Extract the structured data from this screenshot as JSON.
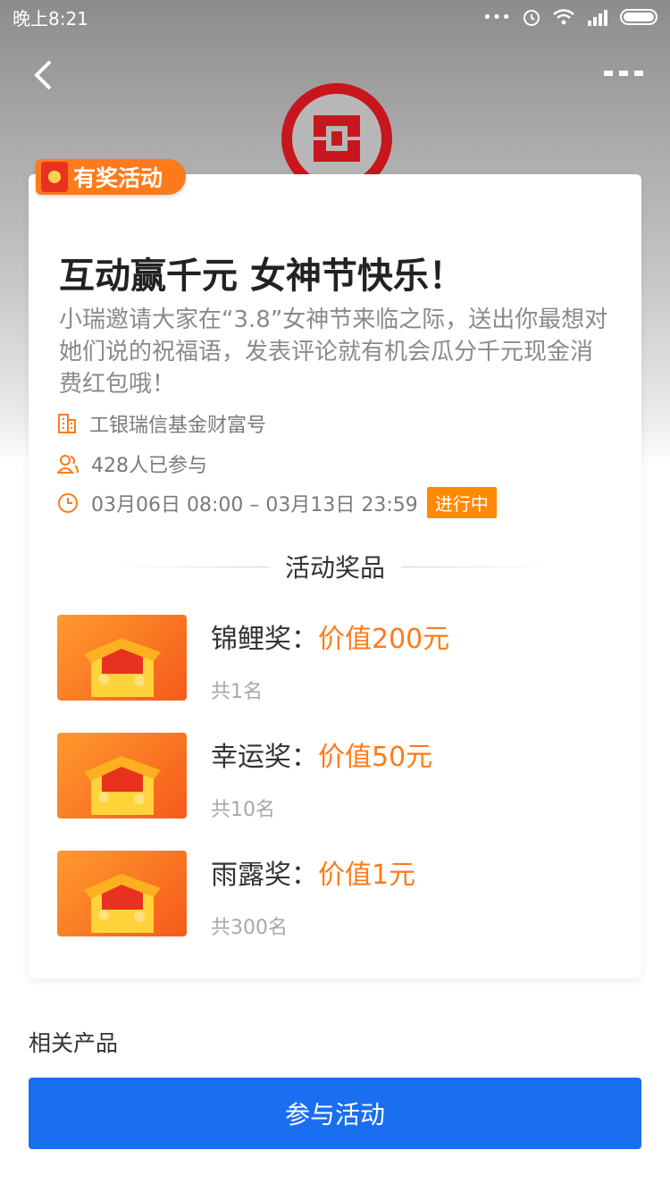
{
  "status_bar": {
    "time": "晚上8:21",
    "dots": "•••",
    "alarm_icon": "alarm-icon",
    "wifi_icon": "wifi-icon",
    "signal_icon": "signal-icon",
    "battery_icon": "battery-icon"
  },
  "nav": {
    "back_icon": "chevron-left-icon",
    "more_icon": "more-icon"
  },
  "promo_tag": {
    "label": "有奖活动",
    "icon": "red-envelope-icon"
  },
  "activity": {
    "title": "互动赢千元 女神节快乐！",
    "description": "小瑞邀请大家在“3.8”女神节来临之际，送出你最想对她们说的祝福语，发表评论就有机会瓜分千元现金消费红包哦！",
    "organizer": "工银瑞信基金财富号",
    "participants": "428人已参与",
    "time_range": "03月06日 08:00 – 03月13日 23:59",
    "status": "进行中"
  },
  "prizes": {
    "heading": "活动奖品",
    "items": [
      {
        "name": "锦鲤奖：",
        "value": "价值200元",
        "count": "共1名"
      },
      {
        "name": "幸运奖：",
        "value": "价值50元",
        "count": "共10名"
      },
      {
        "name": "雨露奖：",
        "value": "价值1元",
        "count": "共300名"
      }
    ]
  },
  "related": {
    "title": "相关产品"
  },
  "action": {
    "join_label": "参与活动"
  },
  "colors": {
    "accent": "#ff7a1a",
    "primary_button": "#1a6ef0",
    "bank_red": "#c8161e"
  }
}
